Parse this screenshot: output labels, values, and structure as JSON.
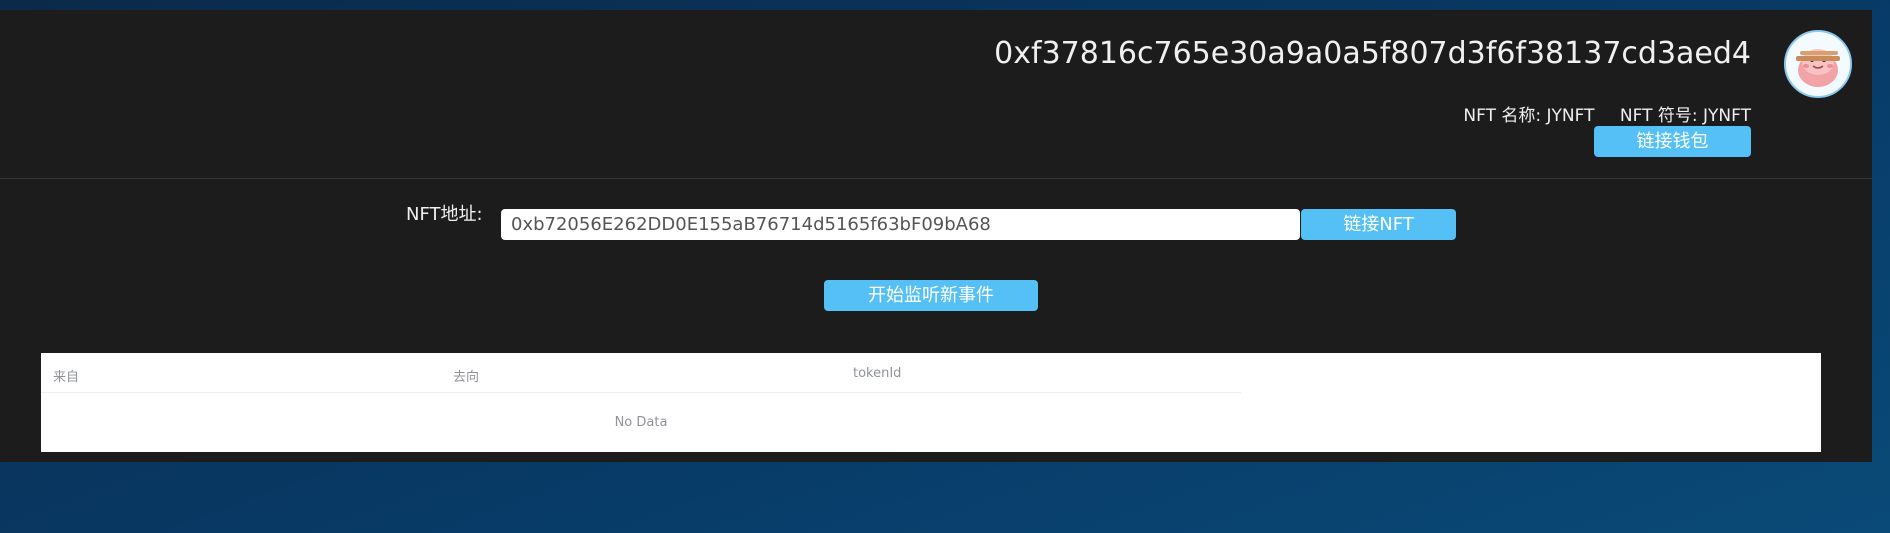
{
  "header": {
    "account_address": "0xf37816c765e30a9a0a5f807d3f6f38137cd3aed4",
    "nft_name": "NFT 名称: JYNFT",
    "nft_symbol": "NFT 符号: JYNFT",
    "connect_wallet_label": "链接钱包",
    "avatar_icon": "cartoon-avatar-icon"
  },
  "form": {
    "address_label": "NFT地址:",
    "address_value": "0xb72056E262DD0E155aB76714d5165f63bF09bA68",
    "connect_nft_label": "链接NFT",
    "listen_label": "开始监听新事件"
  },
  "table": {
    "columns": [
      "来自",
      "去向",
      "tokenId"
    ],
    "empty_text": "No Data"
  },
  "colors": {
    "accent": "#55c0f5",
    "panel": "#1c1c1c",
    "background": "#0a3a66"
  }
}
